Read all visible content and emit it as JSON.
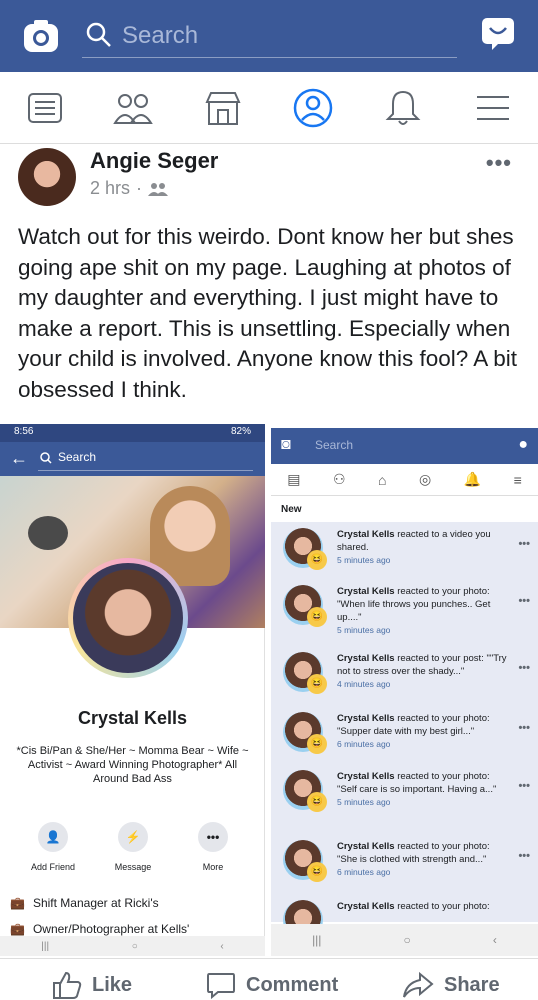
{
  "topbar": {
    "search_placeholder": "Search"
  },
  "navbar": {
    "icons": [
      "news-feed-icon",
      "friends-icon",
      "marketplace-icon",
      "profile-icon",
      "notifications-icon",
      "menu-icon"
    ]
  },
  "post": {
    "author": "Angie Seger",
    "time": "2 hrs",
    "text": "Watch out for this weirdo. Dont know her but shes going ape shit on my page. Laughing at photos of my daughter and everything. I just might have to make a report. This is unsettling. Especially when your child is involved. Anyone know this fool? A bit obsessed I think."
  },
  "left_screenshot": {
    "status_time": "8:56",
    "status_battery": "82%",
    "search_placeholder": "Search",
    "profile_name": "Crystal Kells",
    "bio": "*Cis Bi/Pan & She/Her ~ Momma Bear ~ Wife ~ Activist ~ Award Winning Photographer* All Around Bad Ass",
    "actions": [
      "Add Friend",
      "Message",
      "More"
    ],
    "info1": "Shift Manager at Ricki's",
    "info2": "Owner/Photographer at Kells'"
  },
  "right_screenshot": {
    "search_placeholder": "Search",
    "new_label": "New",
    "notifications": [
      {
        "name": "Crystal Kells",
        "text": "reacted to a video you shared.",
        "time": "5 minutes ago"
      },
      {
        "name": "Crystal Kells",
        "text": "reacted to your photo: \"When life throws you punches.. Get up....\"",
        "time": "5 minutes ago"
      },
      {
        "name": "Crystal Kells",
        "text": "reacted to your post: \"\"Try not to stress over the shady...\"",
        "time": "4 minutes ago"
      },
      {
        "name": "Crystal Kells",
        "text": "reacted to your photo: \"Supper date with my best girl...\"",
        "time": "6 minutes ago"
      },
      {
        "name": "Crystal Kells",
        "text": "reacted to your photo: \"Self care is so important. Having a...\"",
        "time": "5 minutes ago"
      },
      {
        "name": "Crystal Kells",
        "text": "reacted to your photo: \"She is clothed with strength and...\"",
        "time": "6 minutes ago"
      },
      {
        "name": "Crystal Kells",
        "text": "reacted to your photo:",
        "time": ""
      }
    ]
  },
  "actions": {
    "like": "Like",
    "comment": "Comment",
    "share": "Share"
  }
}
